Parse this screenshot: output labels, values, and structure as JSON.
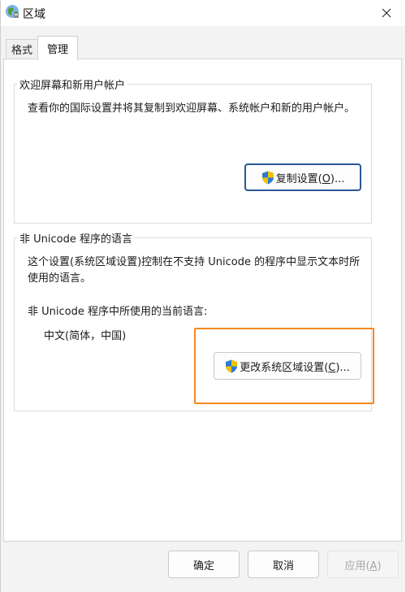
{
  "window": {
    "title": "区域",
    "close_icon": "close-icon",
    "app_icon": "globe-icon"
  },
  "tabs": [
    {
      "label": "格式",
      "active": false
    },
    {
      "label": "管理",
      "active": true
    }
  ],
  "welcome_group": {
    "title": "欢迎屏幕和新用户帐户",
    "description": "查看你的国际设置并将其复制到欢迎屏幕、系统帐户和新的用户帐户。",
    "copy_button": {
      "text": "复制设置(",
      "mnemonic": "O",
      "suffix": ")...",
      "icon": "shield-icon"
    }
  },
  "unicode_group": {
    "title": "非 Unicode 程序的语言",
    "description": "这个设置(系统区域设置)控制在不支持 Unicode 的程序中显示文本时所使用的语言。",
    "current_label": "非 Unicode 程序中所使用的当前语言:",
    "current_value": "中文(简体，中国)",
    "change_button": {
      "text": "更改系统区域设置(",
      "mnemonic": "C",
      "suffix": ")...",
      "icon": "shield-icon"
    }
  },
  "footer": {
    "ok": "确定",
    "cancel": "取消",
    "apply_text": "应用(",
    "apply_mnemonic": "A",
    "apply_suffix": ")",
    "apply_enabled": false
  },
  "colors": {
    "highlight": "#f5891f",
    "default_button_border": "#2b5797"
  }
}
